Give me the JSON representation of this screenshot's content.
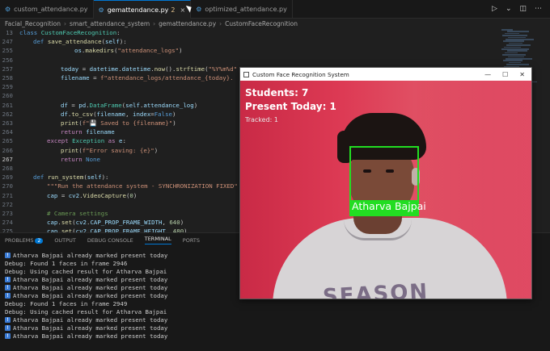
{
  "tabs": [
    {
      "label": "custom_attendance.py",
      "modified": ""
    },
    {
      "label": "gemattendance.py",
      "modified": "2"
    },
    {
      "label": "optimized_attendance.py",
      "modified": ""
    }
  ],
  "breadcrumb": [
    "Facial_Recognition",
    "smart_attendance_system",
    "gemattendance.py",
    "CustomFaceRecognition"
  ],
  "code_lines": [
    {
      "n": "13",
      "html": "<span class='kw'>class</span> <span class='cls'>CustomFaceRecognition</span><span class='pl'>:</span>",
      "indent": 0
    },
    {
      "n": "247",
      "html": "<span class='kw'>def</span> <span class='fn'>save_attendance</span><span class='pl'>(</span><span class='var'>self</span><span class='pl'>):</span>",
      "indent": 1
    },
    {
      "n": "255",
      "html": "<span class='var'>os</span><span class='pl'>.</span><span class='fn'>makedirs</span><span class='pl'>(</span><span class='str'>\"attendance_logs\"</span><span class='pl'>)</span>",
      "indent": 4
    },
    {
      "n": "256",
      "html": "",
      "indent": 0
    },
    {
      "n": "257",
      "html": "<span class='var'>today</span> <span class='pl'>=</span> <span class='var'>datetime</span><span class='pl'>.</span><span class='var'>datetime</span><span class='pl'>.</span><span class='fn'>now</span><span class='pl'>().</span><span class='fn'>strftime</span><span class='pl'>(</span><span class='str'>\"%Y%m%d\"</span>",
      "indent": 3
    },
    {
      "n": "258",
      "html": "<span class='var'>filename</span> <span class='pl'>=</span> <span class='str'>f\"attendance_logs/attendance_{today}.</span>",
      "indent": 3
    },
    {
      "n": "259",
      "html": "",
      "indent": 0
    },
    {
      "n": "260",
      "html": "",
      "indent": 0
    },
    {
      "n": "261",
      "html": "<span class='var'>df</span> <span class='pl'>=</span> <span class='var'>pd</span><span class='pl'>.</span><span class='cls'>DataFrame</span><span class='pl'>(</span><span class='var'>self</span><span class='pl'>.</span><span class='var'>attendance_log</span><span class='pl'>)</span>",
      "indent": 3
    },
    {
      "n": "262",
      "html": "<span class='var'>df</span><span class='pl'>.</span><span class='fn'>to_csv</span><span class='pl'>(</span><span class='var'>filename</span><span class='pl'>, </span><span class='var'>index</span><span class='pl'>=</span><span class='kw'>False</span><span class='pl'>)</span>",
      "indent": 3
    },
    {
      "n": "263",
      "html": "<span class='fn'>print</span><span class='pl'>(</span><span class='str'>f\"💾 Saved to {filename}\"</span><span class='pl'>)</span>",
      "indent": 3
    },
    {
      "n": "264",
      "html": "<span class='kw2'>return</span> <span class='var'>filename</span>",
      "indent": 3
    },
    {
      "n": "265",
      "html": "<span class='kw2'>except</span> <span class='cls'>Exception</span> <span class='kw2'>as</span> <span class='var'>e</span><span class='pl'>:</span>",
      "indent": 2
    },
    {
      "n": "266",
      "html": "<span class='fn'>print</span><span class='pl'>(</span><span class='str'>f\"Error saving: {e}\"</span><span class='pl'>)</span>",
      "indent": 3
    },
    {
      "n": "267",
      "html": "<span class='kw2'>return</span> <span class='kw'>None</span>",
      "indent": 3
    },
    {
      "n": "268",
      "html": "",
      "indent": 0
    },
    {
      "n": "269",
      "html": "<span class='kw'>def</span> <span class='fn'>run_system</span><span class='pl'>(</span><span class='var'>self</span><span class='pl'>):</span>",
      "indent": 1
    },
    {
      "n": "270",
      "html": "<span class='str'>\"\"\"Run the attendance system - SYNCHRONIZATION FIXED\"</span>",
      "indent": 2
    },
    {
      "n": "271",
      "html": "<span class='var'>cap</span> <span class='pl'>=</span> <span class='var'>cv2</span><span class='pl'>.</span><span class='fn'>VideoCapture</span><span class='pl'>(</span><span class='num'>0</span><span class='pl'>)</span>",
      "indent": 2
    },
    {
      "n": "272",
      "html": "",
      "indent": 0
    },
    {
      "n": "273",
      "html": "<span class='cm'># Camera settings</span>",
      "indent": 2
    },
    {
      "n": "274",
      "html": "<span class='var'>cap</span><span class='pl'>.</span><span class='fn'>set</span><span class='pl'>(</span><span class='var'>cv2</span><span class='pl'>.</span><span class='var'>CAP_PROP_FRAME_WIDTH</span><span class='pl'>, </span><span class='num'>640</span><span class='pl'>)</span>",
      "indent": 2
    },
    {
      "n": "275",
      "html": "<span class='var'>cap</span><span class='pl'>.</span><span class='fn'>set</span><span class='pl'>(</span><span class='var'>cv2</span><span class='pl'>.</span><span class='var'>CAP_PROP_FRAME_HEIGHT</span><span class='pl'>, </span><span class='num'>480</span><span class='pl'>)</span>",
      "indent": 2
    },
    {
      "n": "276",
      "html": "<span class='var'>cap</span><span class='pl'>.</span><span class='fn'>set</span><span class='pl'>(</span><span class='var'>cv2</span><span class='pl'>.</span><span class='var'>CAP_PROP_FPS</span><span class='pl'>, </span><span class='num'>30</span><span class='pl'>)</span>",
      "indent": 2
    }
  ],
  "panel_tabs": [
    {
      "label": "PROBLEMS",
      "badge": "2"
    },
    {
      "label": "OUTPUT",
      "badge": ""
    },
    {
      "label": "DEBUG CONSOLE",
      "badge": ""
    },
    {
      "label": "TERMINAL",
      "badge": ""
    },
    {
      "label": "PORTS",
      "badge": ""
    }
  ],
  "terminal_lines": [
    {
      "icon": true,
      "text": "Atharva Bajpai already marked present today"
    },
    {
      "icon": false,
      "text": "Debug: Found 1 faces in frame 2946"
    },
    {
      "icon": false,
      "text": "Debug: Using cached result for Atharva Bajpai"
    },
    {
      "icon": true,
      "text": "Atharva Bajpai already marked present today"
    },
    {
      "icon": true,
      "text": "Atharva Bajpai already marked present today"
    },
    {
      "icon": true,
      "text": "Atharva Bajpai already marked present today"
    },
    {
      "icon": false,
      "text": "Debug: Found 1 faces in frame 2949"
    },
    {
      "icon": false,
      "text": "Debug: Using cached result for Atharva Bajpai"
    },
    {
      "icon": true,
      "text": "Atharva Bajpai already marked present today"
    },
    {
      "icon": true,
      "text": "Atharva Bajpai already marked present today"
    },
    {
      "icon": true,
      "text": "Atharva Bajpai already marked present today"
    }
  ],
  "window": {
    "title": "Custom Face Recognition System",
    "students": "Students: 7",
    "present": "Present Today: 1",
    "tracked": "Tracked: 1",
    "name_label": "Atharva Bajpai",
    "shirt_text": "SEASON",
    "box_color": "#22dd22"
  },
  "colors": {
    "accent": "#0078d4",
    "editor_bg": "#1f1f1f"
  }
}
